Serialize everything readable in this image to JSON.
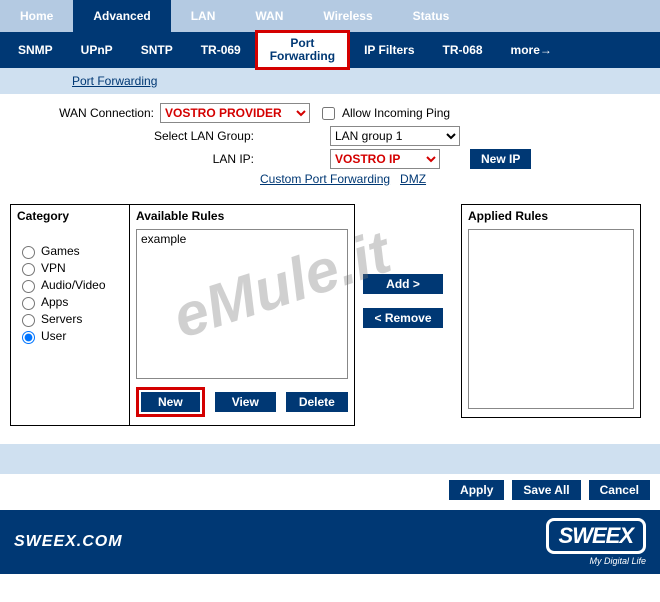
{
  "top_tabs": [
    "Home",
    "Advanced",
    "LAN",
    "WAN",
    "Wireless",
    "Status"
  ],
  "top_active_index": 1,
  "sub_tabs": [
    "SNMP",
    "UPnP",
    "SNTP",
    "TR-069",
    "Port Forwarding",
    "IP Filters",
    "TR-068",
    "more→"
  ],
  "sub_active_index": 4,
  "breadcrumb": "Port Forwarding",
  "form": {
    "wan_label": "WAN Connection:",
    "wan_value": "VOSTRO PROVIDER",
    "allow_ping_label": "Allow Incoming Ping",
    "allow_ping_checked": false,
    "lan_group_label": "Select LAN Group:",
    "lan_group_value": "LAN group 1",
    "lan_ip_label": "LAN IP:",
    "lan_ip_value": "VOSTRO IP",
    "new_ip_btn": "New IP",
    "custom_link": "Custom Port Forwarding",
    "dmz_link": "DMZ"
  },
  "categories": {
    "title": "Category",
    "items": [
      "Games",
      "VPN",
      "Audio/Video",
      "Apps",
      "Servers",
      "User"
    ],
    "selected_index": 5
  },
  "available": {
    "title": "Available Rules",
    "items": [
      "example"
    ],
    "new_btn": "New",
    "view_btn": "View",
    "delete_btn": "Delete"
  },
  "mid": {
    "add_btn": "Add >",
    "remove_btn": "< Remove"
  },
  "applied": {
    "title": "Applied Rules",
    "items": []
  },
  "actions": {
    "apply": "Apply",
    "save_all": "Save All",
    "cancel": "Cancel"
  },
  "footer": {
    "site": "SWEEX.COM",
    "brand": "SWEEX",
    "tagline": "My Digital Life"
  },
  "watermark": "eMule.it"
}
